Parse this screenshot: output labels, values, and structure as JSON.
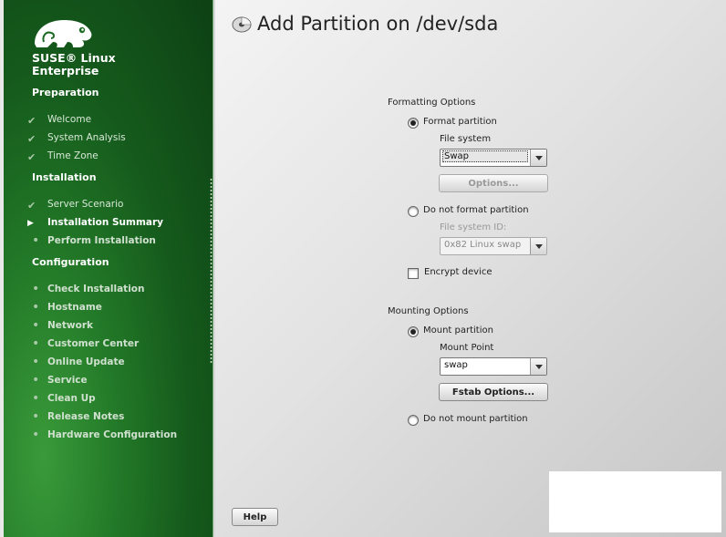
{
  "brand": {
    "line1": "SUSE® Linux",
    "line2": "Enterprise"
  },
  "sidebar": {
    "sections": [
      {
        "title": "Preparation",
        "items": [
          {
            "label": "Welcome",
            "state": "done"
          },
          {
            "label": "System Analysis",
            "state": "done"
          },
          {
            "label": "Time Zone",
            "state": "done"
          }
        ]
      },
      {
        "title": "Installation",
        "items": [
          {
            "label": "Server Scenario",
            "state": "done"
          },
          {
            "label": "Installation Summary",
            "state": "current"
          },
          {
            "label": "Perform Installation",
            "state": "todo"
          }
        ]
      },
      {
        "title": "Configuration",
        "items": [
          {
            "label": "Check Installation",
            "state": "todo"
          },
          {
            "label": "Hostname",
            "state": "todo"
          },
          {
            "label": "Network",
            "state": "todo"
          },
          {
            "label": "Customer Center",
            "state": "todo"
          },
          {
            "label": "Online Update",
            "state": "todo"
          },
          {
            "label": "Service",
            "state": "todo"
          },
          {
            "label": "Clean Up",
            "state": "todo"
          },
          {
            "label": "Release Notes",
            "state": "todo"
          },
          {
            "label": "Hardware Configuration",
            "state": "todo"
          }
        ]
      }
    ]
  },
  "page": {
    "title": "Add Partition on /dev/sda"
  },
  "formatting": {
    "group_label": "Formatting Options",
    "format_label": "Format partition",
    "format_selected": true,
    "fs_label": "File system",
    "fs_value": "Swap",
    "options_button": "Options...",
    "noformat_label": "Do not format partition",
    "fsid_label": "File system ID:",
    "fsid_value": "0x82 Linux swap",
    "encrypt_label": "Encrypt device",
    "encrypt_checked": false
  },
  "mounting": {
    "group_label": "Mounting Options",
    "mount_label": "Mount partition",
    "mount_selected": true,
    "mountpoint_label": "Mount Point",
    "mountpoint_value": "swap",
    "fstab_button": "Fstab Options...",
    "nomount_label": "Do not mount partition"
  },
  "footer": {
    "help_button": "Help"
  },
  "colors": {
    "sidebar_green": "#1d6b24",
    "accent_green": "#6fb43f"
  },
  "icons": {
    "logo": "chameleon-logo",
    "done": "check-icon",
    "current": "triangle-right-icon",
    "todo": "bullet-icon",
    "title": "partition-disk-icon"
  }
}
